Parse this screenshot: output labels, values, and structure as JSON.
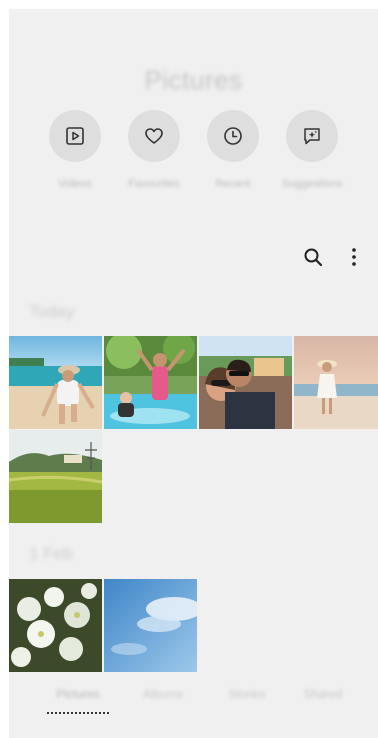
{
  "header": {
    "title": "Pictures"
  },
  "quick_actions": [
    {
      "label": "Videos",
      "icon": "play-icon"
    },
    {
      "label": "Favourites",
      "icon": "heart-icon"
    },
    {
      "label": "Recent",
      "icon": "clock-icon"
    },
    {
      "label": "Suggestions",
      "icon": "sparkle-chat-icon"
    }
  ],
  "toolbar": {
    "search_icon": "search-icon",
    "more_icon": "more-vertical-icon"
  },
  "sections": [
    {
      "label": "Today"
    },
    {
      "label": "1 Feb"
    }
  ],
  "bottom_tabs": [
    {
      "label": "Pictures",
      "active": true
    },
    {
      "label": "Albums",
      "active": false
    },
    {
      "label": "Stories",
      "active": false
    },
    {
      "label": "Shared",
      "active": false
    }
  ],
  "colors": {
    "background": "#f0f0f0",
    "circle": "#dedede",
    "icon": "#333333"
  }
}
